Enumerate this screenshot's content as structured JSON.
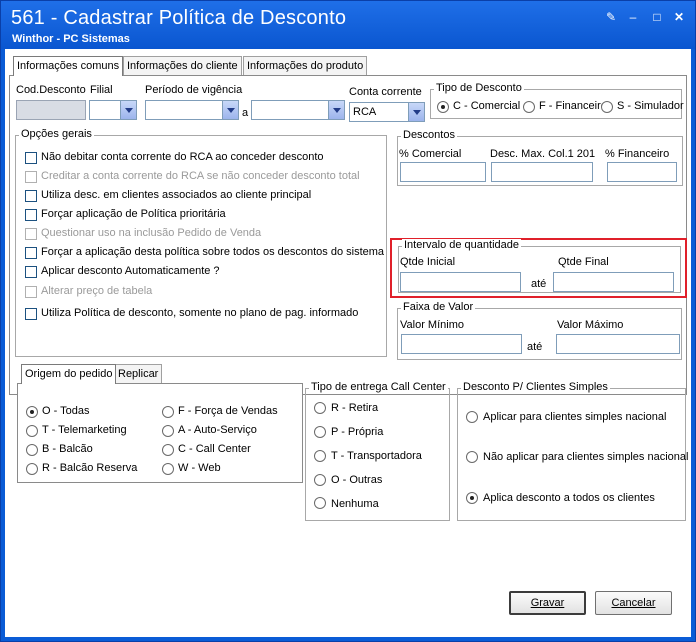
{
  "window": {
    "title": "561 - Cadastrar Política de Desconto",
    "subtitle": "Winthor - PC Sistemas",
    "controls": [
      "edit-icon",
      "minimize-icon",
      "maximize-icon",
      "close-icon"
    ]
  },
  "tabs": [
    "Informações comuns",
    "Informações do cliente",
    "Informações do produto"
  ],
  "header": {
    "cod_desconto_label": "Cod.Desconto",
    "filial_label": "Filial",
    "periodo_label": "Período de vigência",
    "a_label": "a",
    "conta_corrente_label": "Conta corrente",
    "conta_corrente_value": "RCA"
  },
  "tipo_desconto": {
    "title": "Tipo de Desconto",
    "options": [
      "C - Comercial",
      "F - Financeiro",
      "S - Simulador"
    ],
    "selected": 0
  },
  "opcoes_gerais": {
    "title": "Opções gerais",
    "items": [
      {
        "label": "Não debitar conta corrente do RCA ao conceder desconto",
        "enabled": true
      },
      {
        "label": "Creditar a conta corrente do RCA se não conceder desconto total",
        "enabled": false
      },
      {
        "label": "Utiliza desc. em clientes associados ao cliente principal",
        "enabled": true
      },
      {
        "label": "Forçar aplicação de Política prioritária",
        "enabled": true
      },
      {
        "label": "Questionar uso na inclusão Pedido de Venda",
        "enabled": false
      },
      {
        "label": "Forçar a aplicação desta política sobre todos os descontos do sistema",
        "enabled": true
      },
      {
        "label": "Aplicar desconto Automaticamente ?",
        "enabled": true
      },
      {
        "label": "Alterar preço de tabela",
        "enabled": false
      },
      {
        "label": "Utiliza Política de desconto, somente no plano de pag. informado",
        "enabled": true
      }
    ]
  },
  "descontos": {
    "title": "Descontos",
    "comercial_label": "% Comercial",
    "max_col_label": "Desc. Max. Col.1 201",
    "financeiro_label": "% Financeiro"
  },
  "intervalo": {
    "title": "Intervalo de quantidade",
    "inicial_label": "Qtde Inicial",
    "final_label": "Qtde Final",
    "ate_label": "até"
  },
  "faixa_valor": {
    "title": "Faixa de Valor",
    "minimo_label": "Valor Mínimo",
    "maximo_label": "Valor Máximo",
    "ate_label": "até"
  },
  "bottom_tabs": [
    "Origem do pedido",
    "Replicar"
  ],
  "origem_pedido": {
    "col1": [
      "O - Todas",
      "T - Telemarketing",
      "B - Balcão",
      "R - Balcão Reserva"
    ],
    "col2": [
      "F - Força de Vendas",
      "A - Auto-Serviço",
      "C - Call Center",
      "W - Web"
    ],
    "selected": "O - Todas"
  },
  "tipo_entrega": {
    "title": "Tipo de entrega Call Center",
    "options": [
      "R - Retira",
      "P - Própria",
      "T - Transportadora",
      "O - Outras",
      "Nenhuma"
    ]
  },
  "clientes_simples": {
    "title": "Desconto P/ Clientes Simples",
    "options": [
      "Aplicar para clientes simples nacional",
      "Não aplicar para clientes simples nacional",
      "Aplica desconto a todos os clientes"
    ],
    "selected": 2
  },
  "buttons": {
    "gravar": "Gravar",
    "cancelar": "Cancelar"
  }
}
